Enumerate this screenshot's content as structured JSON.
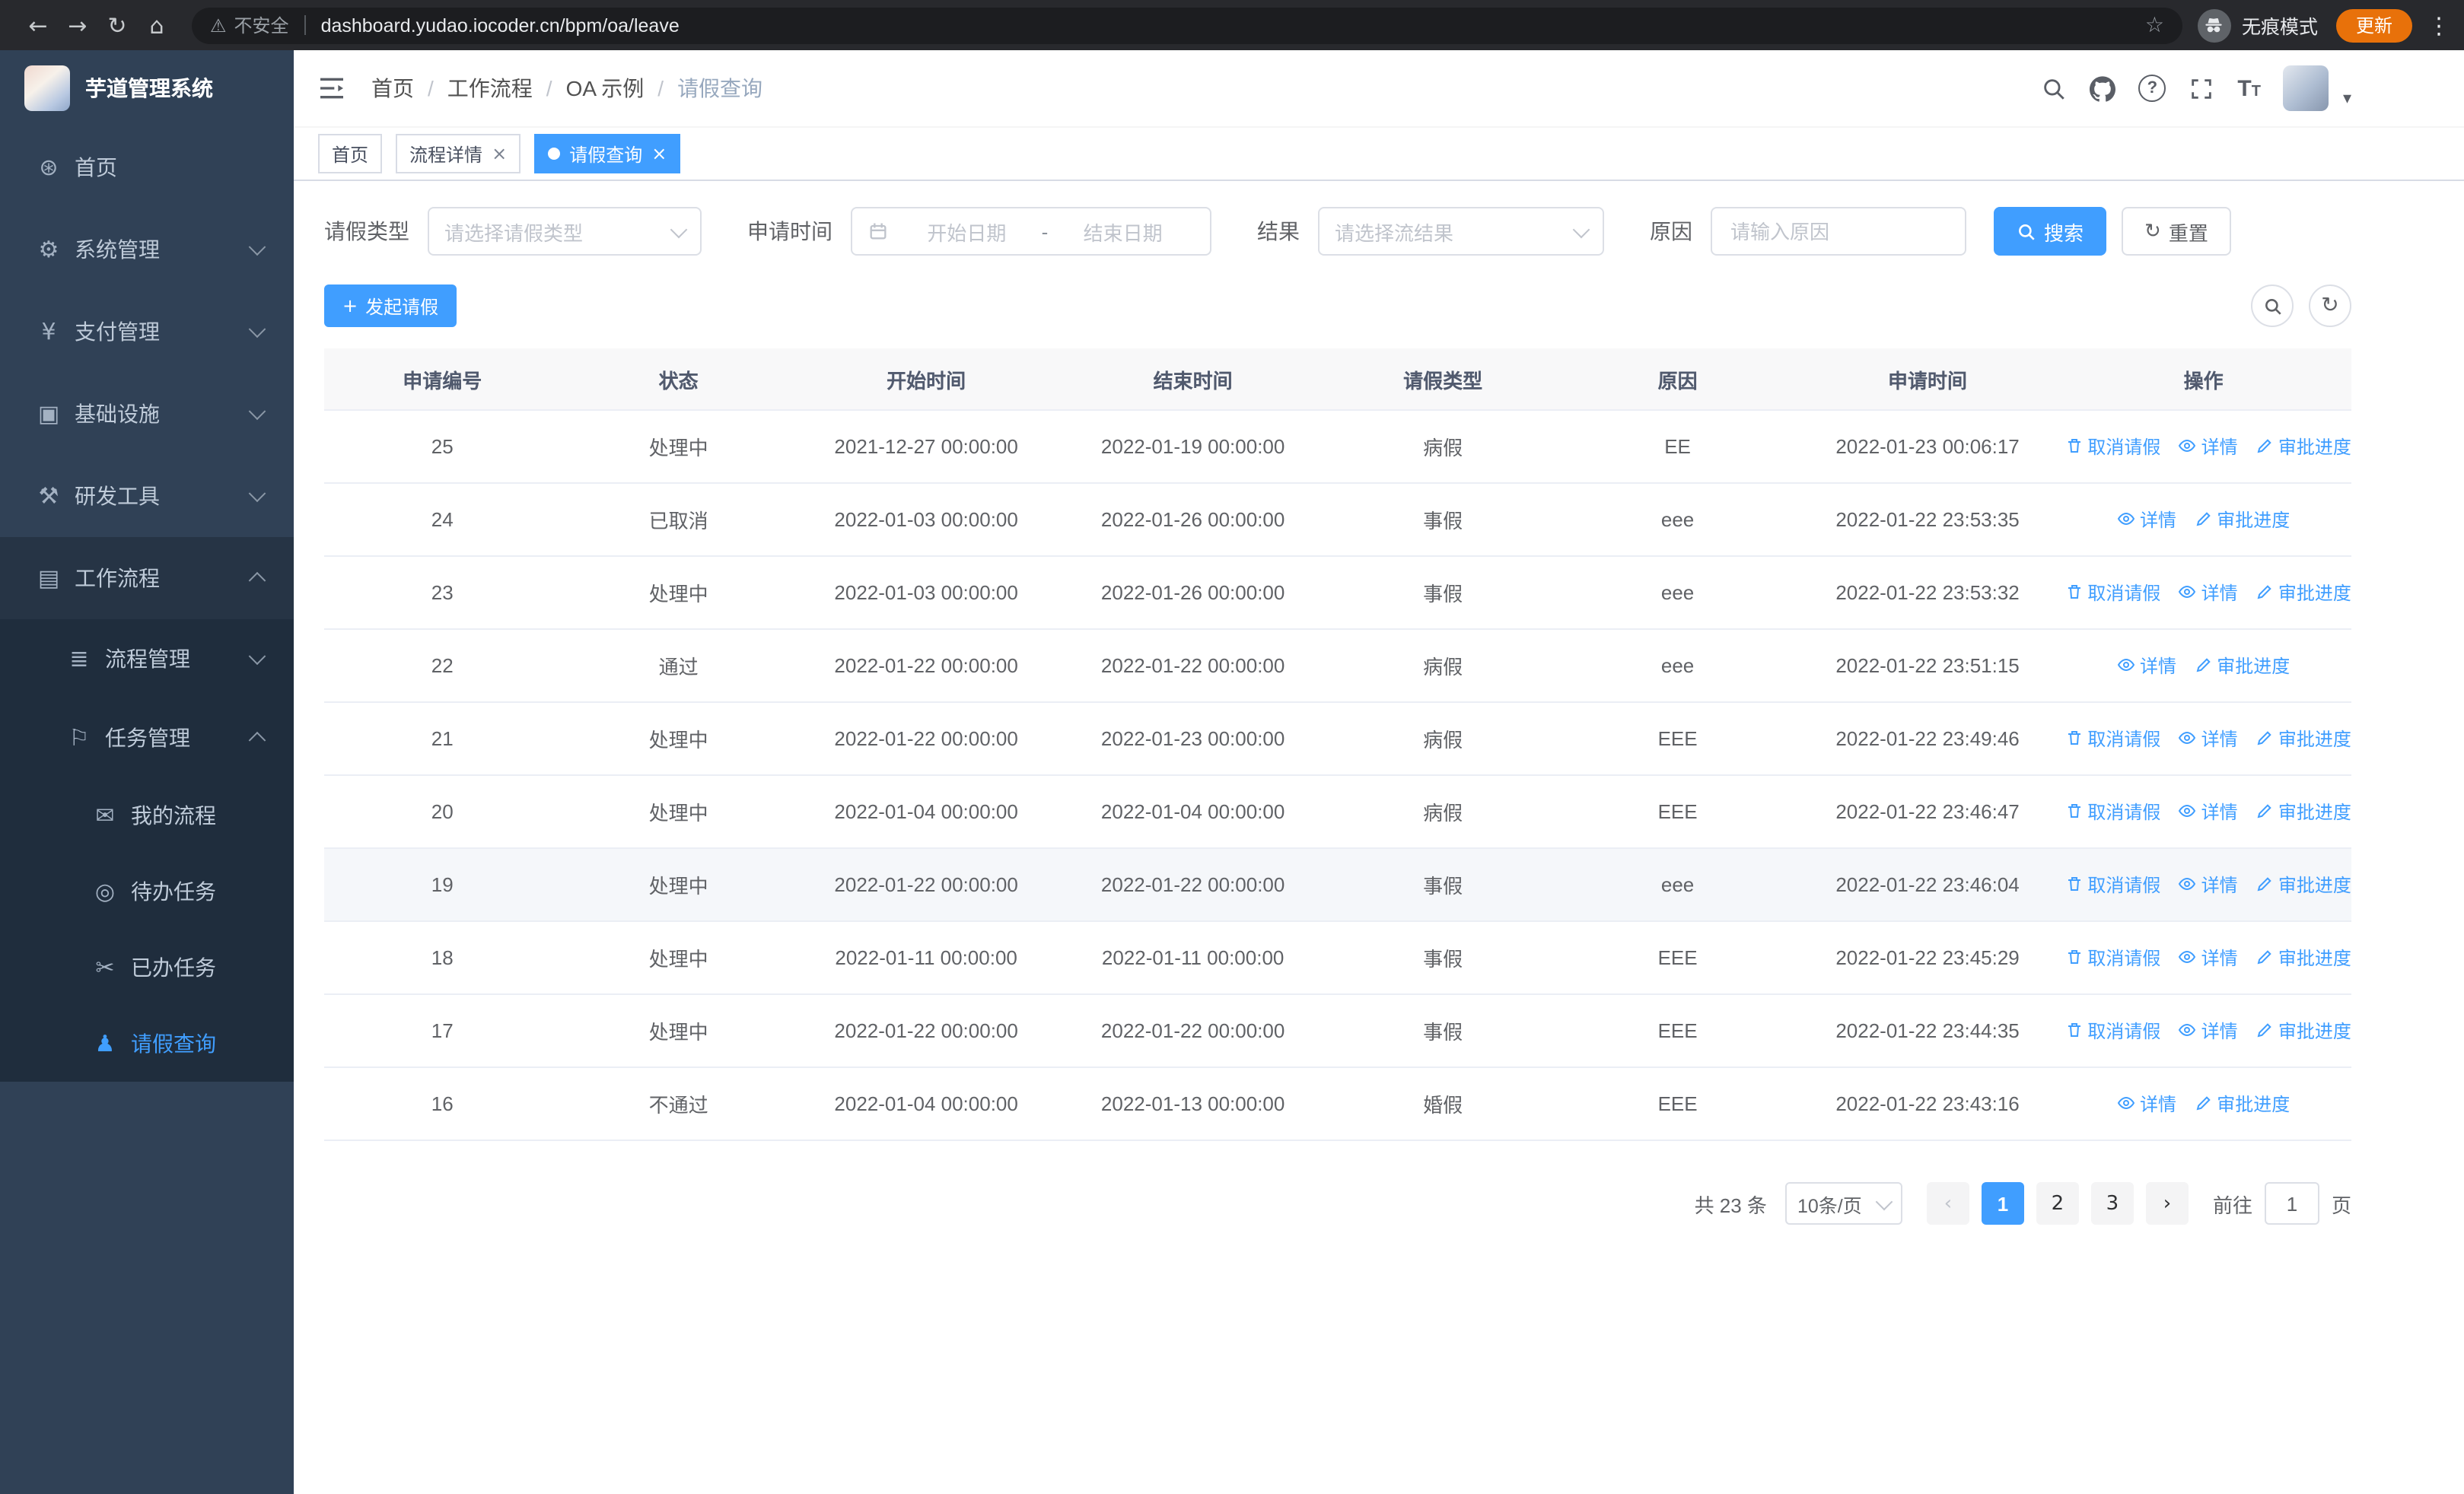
{
  "browser": {
    "security_warning": "不安全",
    "url": "dashboard.yudao.iocoder.cn/bpm/oa/leave",
    "incognito_label": "无痕模式",
    "update_button": "更新"
  },
  "colors": {
    "accent": "#409eff",
    "sidebar_bg": "#304156",
    "submenu_bg": "#1f2d3d",
    "update_chip": "#e8710a"
  },
  "icons": {
    "back": "←",
    "forward": "→",
    "reload": "↻",
    "home": "⌂",
    "warning": "⚠",
    "star": "☆",
    "menu_dots": "⋮",
    "dashboard": "⊛",
    "gear": "⚙",
    "yen": "¥",
    "infrastructure": "▣",
    "devtools": "⚒",
    "workflow": "▤",
    "process": "≣",
    "task": "⚐",
    "my_process": "✉",
    "todo": "◎",
    "done": "✂",
    "person": "♟",
    "plus": "+",
    "refresh": "↻",
    "caret_down": "▾",
    "question": "?",
    "font_size": "T",
    "close": "×",
    "prev": "‹",
    "next": "›"
  },
  "sidebar": {
    "logo_title": "芋道管理系统",
    "items": [
      {
        "label": "首页"
      },
      {
        "label": "系统管理",
        "expandable": true
      },
      {
        "label": "支付管理",
        "expandable": true
      },
      {
        "label": "基础设施",
        "expandable": true
      },
      {
        "label": "研发工具",
        "expandable": true
      },
      {
        "label": "工作流程",
        "expandable": true,
        "expanded": true
      },
      {
        "label": "流程管理",
        "expandable": true
      },
      {
        "label": "任务管理",
        "expandable": true,
        "expanded": true
      },
      {
        "label": "我的流程"
      },
      {
        "label": "待办任务"
      },
      {
        "label": "已办任务"
      },
      {
        "label": "请假查询",
        "active": true
      }
    ]
  },
  "header": {
    "breadcrumb": [
      "首页",
      "工作流程",
      "OA 示例",
      "请假查询"
    ],
    "separator": "/"
  },
  "tabs": [
    {
      "label": "首页",
      "closable": false,
      "active": false
    },
    {
      "label": "流程详情",
      "closable": true,
      "active": false
    },
    {
      "label": "请假查询",
      "closable": true,
      "active": true
    }
  ],
  "filters": {
    "leave_type_label": "请假类型",
    "leave_type_placeholder": "请选择请假类型",
    "apply_time_label": "申请时间",
    "start_date_placeholder": "开始日期",
    "range_separator": "-",
    "end_date_placeholder": "结束日期",
    "result_label": "结果",
    "result_placeholder": "请选择流结果",
    "reason_label": "原因",
    "reason_placeholder": "请输入原因",
    "search_button": "搜索",
    "reset_button": "重置"
  },
  "toolbar": {
    "create_button": "发起请假"
  },
  "table": {
    "columns": [
      "申请编号",
      "状态",
      "开始时间",
      "结束时间",
      "请假类型",
      "原因",
      "申请时间",
      "操作"
    ],
    "actions": {
      "cancel": "取消请假",
      "detail": "详情",
      "progress": "审批进度"
    },
    "rows": [
      {
        "id": "25",
        "status": "处理中",
        "start": "2021-12-27 00:00:00",
        "end": "2022-01-19 00:00:00",
        "type": "病假",
        "reason": "EE",
        "applied": "2022-01-23 00:06:17",
        "cancelable": true
      },
      {
        "id": "24",
        "status": "已取消",
        "start": "2022-01-03 00:00:00",
        "end": "2022-01-26 00:00:00",
        "type": "事假",
        "reason": "eee",
        "applied": "2022-01-22 23:53:35",
        "cancelable": false
      },
      {
        "id": "23",
        "status": "处理中",
        "start": "2022-01-03 00:00:00",
        "end": "2022-01-26 00:00:00",
        "type": "事假",
        "reason": "eee",
        "applied": "2022-01-22 23:53:32",
        "cancelable": true
      },
      {
        "id": "22",
        "status": "通过",
        "start": "2022-01-22 00:00:00",
        "end": "2022-01-22 00:00:00",
        "type": "病假",
        "reason": "eee",
        "applied": "2022-01-22 23:51:15",
        "cancelable": false
      },
      {
        "id": "21",
        "status": "处理中",
        "start": "2022-01-22 00:00:00",
        "end": "2022-01-23 00:00:00",
        "type": "病假",
        "reason": "EEE",
        "applied": "2022-01-22 23:49:46",
        "cancelable": true
      },
      {
        "id": "20",
        "status": "处理中",
        "start": "2022-01-04 00:00:00",
        "end": "2022-01-04 00:00:00",
        "type": "病假",
        "reason": "EEE",
        "applied": "2022-01-22 23:46:47",
        "cancelable": true
      },
      {
        "id": "19",
        "status": "处理中",
        "start": "2022-01-22 00:00:00",
        "end": "2022-01-22 00:00:00",
        "type": "事假",
        "reason": "eee",
        "applied": "2022-01-22 23:46:04",
        "cancelable": true,
        "highlighted": true
      },
      {
        "id": "18",
        "status": "处理中",
        "start": "2022-01-11 00:00:00",
        "end": "2022-01-11 00:00:00",
        "type": "事假",
        "reason": "EEE",
        "applied": "2022-01-22 23:45:29",
        "cancelable": true
      },
      {
        "id": "17",
        "status": "处理中",
        "start": "2022-01-22 00:00:00",
        "end": "2022-01-22 00:00:00",
        "type": "事假",
        "reason": "EEE",
        "applied": "2022-01-22 23:44:35",
        "cancelable": true
      },
      {
        "id": "16",
        "status": "不通过",
        "start": "2022-01-04 00:00:00",
        "end": "2022-01-13 00:00:00",
        "type": "婚假",
        "reason": "EEE",
        "applied": "2022-01-22 23:43:16",
        "cancelable": false
      }
    ]
  },
  "pagination": {
    "total": "共 23 条",
    "page_size": "10条/页",
    "pages": [
      "1",
      "2",
      "3"
    ],
    "current_page": "1",
    "goto_label": "前往",
    "goto_value": "1",
    "page_suffix": "页"
  }
}
